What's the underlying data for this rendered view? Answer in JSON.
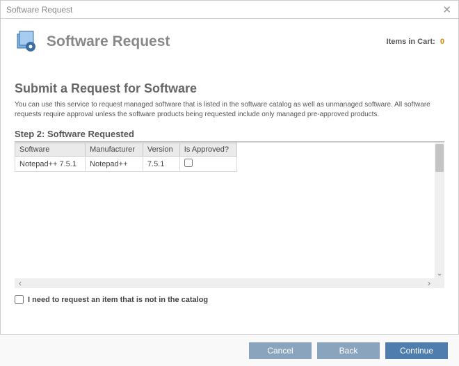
{
  "window": {
    "title": "Software Request"
  },
  "header": {
    "title": "Software Request",
    "cart_label": "Items in Cart:",
    "cart_count": "0"
  },
  "page": {
    "title": "Submit a Request for Software",
    "description": "You can use this service to request managed software that is listed in the software catalog as well as unmanaged software. All software requests require approval unless the software products being requested include only managed pre-approved products.",
    "step_label": "Step 2: Software Requested"
  },
  "table": {
    "columns": [
      "Software",
      "Manufacturer",
      "Version",
      "Is Approved?"
    ],
    "rows": [
      {
        "software": "Notepad++ 7.5.1",
        "manufacturer": "Notepad++",
        "version": "7.5.1",
        "approved": false
      }
    ]
  },
  "catalog_checkbox": {
    "label": "I need to request an item that is not in the catalog",
    "checked": false
  },
  "buttons": {
    "cancel": "Cancel",
    "back": "Back",
    "continue": "Continue"
  }
}
